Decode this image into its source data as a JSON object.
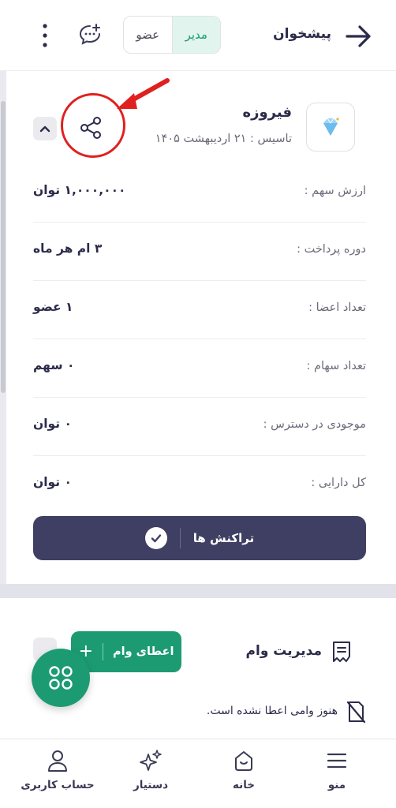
{
  "header": {
    "title": "پیشخوان",
    "role_toggle": {
      "admin_label": "مدیر",
      "member_label": "عضو",
      "selected": "مدیر"
    },
    "icons": [
      "back-arrow-icon",
      "chat-add-icon",
      "more-vertical-icon"
    ]
  },
  "fund": {
    "name": "فیروزه",
    "founded": "تاسیس : ۲۱ اردیبهشت ۱۴۰۵",
    "rows": [
      {
        "label": "ارزش سهم :",
        "value": "۱,۰۰۰,۰۰۰ توان"
      },
      {
        "label": "دوره پرداخت :",
        "value": "۳ ام هر ماه"
      },
      {
        "label": "تعداد اعضا :",
        "value": "۱ عضو"
      },
      {
        "label": "تعداد سهام :",
        "value": "۰ سهم"
      },
      {
        "label": "موجودی در دسترس :",
        "value": "۰ توان"
      },
      {
        "label": "کل دارایی :",
        "value": "۰ توان"
      }
    ],
    "transactions_label": "تراکنش ها"
  },
  "loan": {
    "title": "مدیریت وام",
    "grant_label": "اعطای وام",
    "empty_text": "هنوز وامی اعطا نشده است."
  },
  "bottom_nav": [
    {
      "label": "منو",
      "icon": "menu-icon"
    },
    {
      "label": "خانه",
      "icon": "home-icon"
    },
    {
      "label": "دستیار",
      "icon": "sparkle-icon"
    },
    {
      "label": "حساب کاربری",
      "icon": "user-icon"
    }
  ],
  "colors": {
    "accent_green": "#1c9b73",
    "primary_dark": "#3f3f63",
    "annotation_red": "#e0201f"
  }
}
